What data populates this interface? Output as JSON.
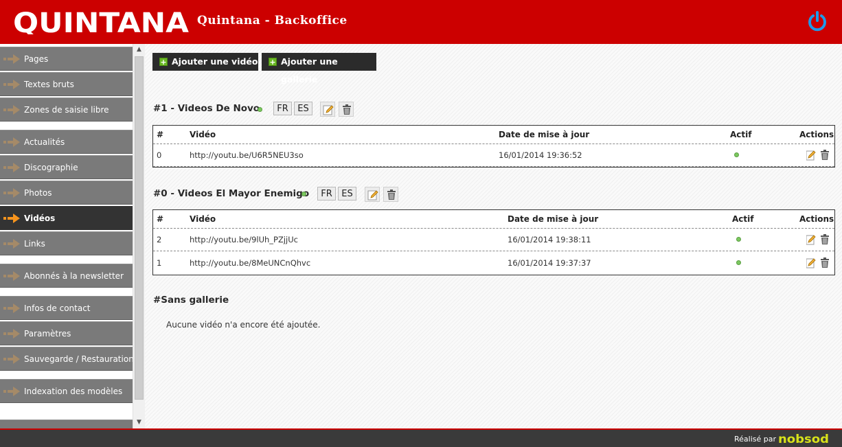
{
  "header": {
    "logo_text": "QUINTANA",
    "title": "Quintana - Backoffice",
    "power_icon": "power-icon"
  },
  "sidebar": {
    "items": [
      {
        "label": "Pages"
      },
      {
        "label": "Textes bruts"
      },
      {
        "label": "Zones de saisie libre"
      },
      {
        "label": "Actualités"
      },
      {
        "label": "Discographie"
      },
      {
        "label": "Photos"
      },
      {
        "label": "Vidéos",
        "active": true
      },
      {
        "label": "Links"
      },
      {
        "label": "Abonnés à la newsletter"
      },
      {
        "label": "Infos de contact"
      },
      {
        "label": "Paramètres"
      },
      {
        "label": "Sauvegarde / Restauration"
      },
      {
        "label": "Indexation des modèles"
      }
    ]
  },
  "toolbar": {
    "add_video_label": "Ajouter une vidéo",
    "add_gallery_label": "Ajouter une gallerie"
  },
  "galleries": [
    {
      "title": "#1 - Videos De Novo",
      "active": true,
      "langs": [
        "FR",
        "ES"
      ],
      "columns": {
        "num": "#",
        "video": "Vidéo",
        "date": "Date de mise à jour",
        "active": "Actif",
        "actions": "Actions"
      },
      "rows": [
        {
          "num": "0",
          "video": "http://youtu.be/U6R5NEU3so",
          "date": "16/01/2014 19:36:52",
          "active": true
        }
      ]
    },
    {
      "title": "#0 - Videos El Mayor Enemigo",
      "active": true,
      "langs": [
        "FR",
        "ES"
      ],
      "columns": {
        "num": "#",
        "video": "Vidéo",
        "date": "Date de mise à jour",
        "active": "Actif",
        "actions": "Actions"
      },
      "rows": [
        {
          "num": "2",
          "video": "http://youtu.be/9lUh_PZjjUc",
          "date": "16/01/2014 19:38:11",
          "active": true
        },
        {
          "num": "1",
          "video": "http://youtu.be/8MeUNCnQhvc",
          "date": "16/01/2014 19:37:37",
          "active": true
        }
      ]
    }
  ],
  "no_gallery": {
    "title": "#Sans gallerie",
    "empty_message": "Aucune vidéo n'a encore été ajoutée."
  },
  "footer": {
    "credit_label": "Réalisé par",
    "brand": "nobsod"
  },
  "colors": {
    "brand_red": "#cc0000",
    "sidebar_gray": "#7a7a7a",
    "active_dark": "#333333",
    "status_green": "#7cc860",
    "accent_orange": "#f7941d"
  }
}
